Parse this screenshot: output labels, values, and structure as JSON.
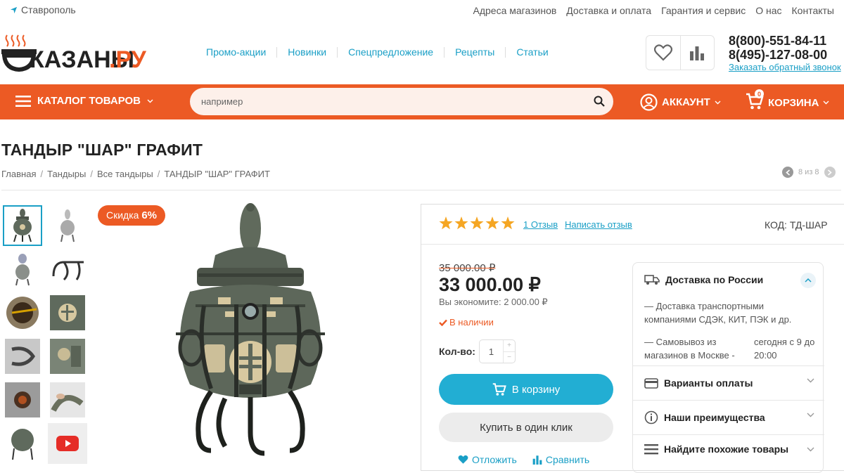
{
  "topbar": {
    "city": "Ставрополь",
    "links": [
      "Адреса магазинов",
      "Доставка и оплата",
      "Гарантия и сервис",
      "О нас",
      "Контакты"
    ]
  },
  "header": {
    "logo_text": "КАЗАНЫ.РУ",
    "nav": [
      "Промо-акции",
      "Новинки",
      "Спецпредложение",
      "Рецепты",
      "Статьи"
    ],
    "phone1": "8(800)-551-84-11",
    "phone2": "8(495)-127-08-00",
    "callback": "Заказать обратный звонок"
  },
  "orangebar": {
    "catalog_label": "КАТАЛОГ ТОВАРОВ",
    "search_placeholder": "например",
    "account_label": "АККАУНТ",
    "cart_label": "КОРЗИНА",
    "cart_count": "0"
  },
  "product": {
    "title": "ТАНДЫР \"ШАР\" ГРАФИТ",
    "breadcrumb": [
      "Главная",
      "Тандыры",
      "Все тандыры",
      "ТАНДЫР \"ШАР\" ГРАФИТ"
    ],
    "pager": "8 из 8",
    "discount_label": "Скидка",
    "discount_value": "6%",
    "rating": 5,
    "reviews_link": "1 Отзыв",
    "write_review": "Написать отзыв",
    "code": "КОД:  ТД-ШАР",
    "old_price": "35 000.00 ₽",
    "price": "33 000.00 ₽",
    "savings": "Вы экономите: 2 000.00 ₽",
    "stock": "В наличии",
    "qty_label": "Кол-во:",
    "qty_value": "1",
    "add_to_cart": "В корзину",
    "one_click": "Купить в один клик",
    "postpone": "Отложить",
    "compare": "Сравнить"
  },
  "side": {
    "delivery_title": "Доставка по России",
    "delivery_text": "— Доставка транспортными компаниями СДЭК, КИТ, ПЭК и др.",
    "pickup_text": "— Самовывоз из магазинов в Москве -",
    "pickup_time": "сегодня с 9 до 20:00",
    "payment": "Варианты оплаты",
    "advantages": "Наши преимущества",
    "similar": "Найдите похожие товары"
  },
  "colors": {
    "accent": "#ec5a24",
    "link": "#1a9fc6",
    "button": "#22aed3",
    "star": "#f5a623"
  }
}
